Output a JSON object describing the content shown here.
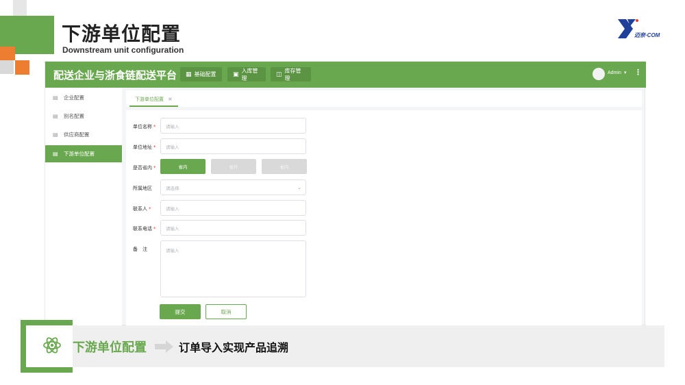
{
  "slide": {
    "title": "下游单位配置",
    "subtitle": "Downstream unit configuration",
    "logo_text": "迈奈·COM",
    "accent_color": "#6aa84f",
    "orange_color": "#ed7d31"
  },
  "app": {
    "title": "配送企业与浙食链配送平台",
    "nav": [
      {
        "label": "基础配置",
        "icon": "grid-icon"
      },
      {
        "label": "入库管理",
        "icon": "image-icon"
      },
      {
        "label": "库存管理",
        "icon": "box-icon"
      }
    ],
    "user": {
      "name": "Admin"
    }
  },
  "sidebar": {
    "items": [
      {
        "label": "企业配置",
        "active": false
      },
      {
        "label": "别名配置",
        "active": false
      },
      {
        "label": "供应商配置",
        "active": false
      },
      {
        "label": "下游单位配置",
        "active": true
      }
    ]
  },
  "tabs": [
    {
      "label": "下游单位配置",
      "close": "×"
    }
  ],
  "form": {
    "unit_name": {
      "label": "单位名称",
      "required": "*",
      "placeholder": "请输入"
    },
    "unit_address": {
      "label": "单位地址",
      "required": "*",
      "placeholder": "请输入"
    },
    "in_province": {
      "label": "是否省内",
      "required": "*",
      "options": [
        "省内",
        "省外",
        "省内"
      ],
      "selected": 0
    },
    "region": {
      "label": "所属地区",
      "placeholder": "请选择"
    },
    "contact": {
      "label": "联系人",
      "required": "*",
      "placeholder": "请输入"
    },
    "phone": {
      "label": "联系电话",
      "required": "*",
      "placeholder": "请输入"
    },
    "remark": {
      "label": "备　注",
      "placeholder": "请输入"
    },
    "submit_label": "提交",
    "cancel_label": "取消"
  },
  "banner": {
    "left_text": "下游单位配置",
    "right_text": "订单导入实现产品追溯"
  }
}
